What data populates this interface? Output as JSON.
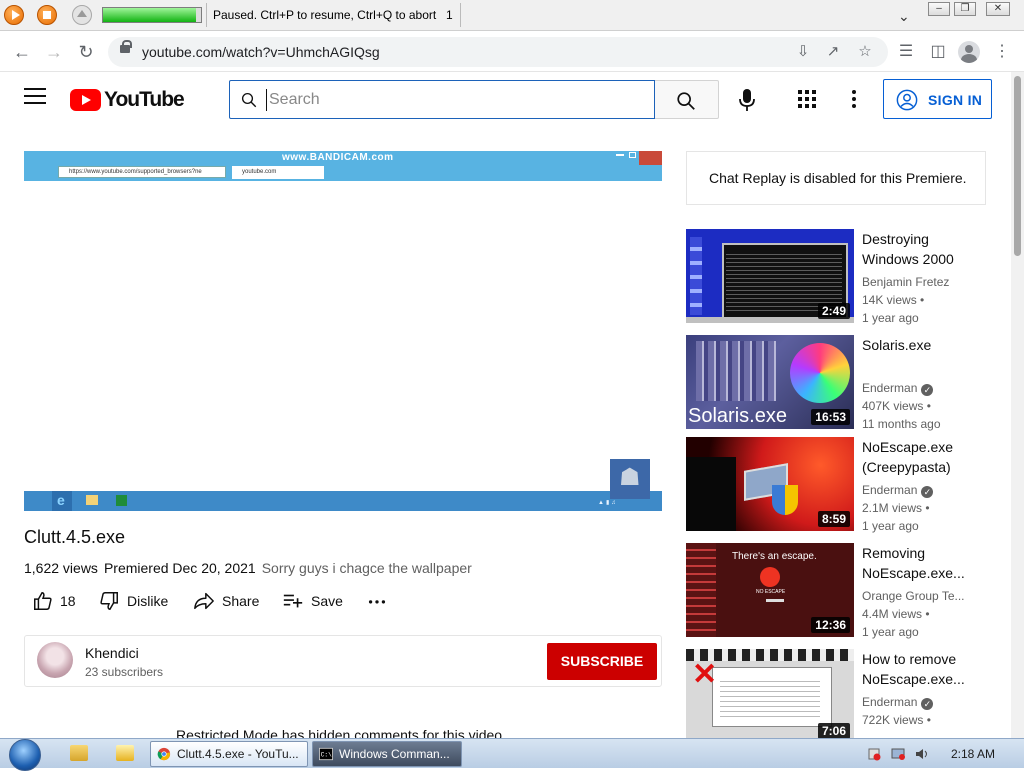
{
  "recorder": {
    "status": "Paused. Ctrl+P to resume, Ctrl+Q to abort",
    "count": "1",
    "progress": 0.95
  },
  "browser": {
    "url": "youtube.com/watch?v=UhmchAGIQsg"
  },
  "youtube": {
    "logo_text": "YouTube",
    "search_placeholder": "Search",
    "signin_label": "SIGN IN"
  },
  "player": {
    "watermark": "www.BANDICAM.com",
    "address": "https://www.youtube.com/supported_browsers?ne",
    "tab": "youtube.com"
  },
  "video": {
    "title": "Clutt.4.5.exe",
    "views": "1,622 views",
    "premiered": "Premiered Dec 20, 2021",
    "description": "Sorry guys i chagce the wallpaper",
    "actions": {
      "likes": "18",
      "dislike": "Dislike",
      "share": "Share",
      "save": "Save"
    }
  },
  "channel": {
    "name": "Khendici",
    "subscribers": "23 subscribers",
    "subscribe_label": "SUBSCRIBE"
  },
  "restricted_notice": "Restricted Mode has hidden comments for this video.",
  "chat_replay": "Chat Replay is disabled for this Premiere.",
  "recommendations": [
    {
      "title": "Destroying Windows 2000",
      "channel": "Benjamin Fretez",
      "views": "14K views •",
      "ago": "1 year ago",
      "duration": "2:49",
      "verified": false
    },
    {
      "title": "Solaris.exe",
      "channel": "Enderman",
      "views": "407K views •",
      "ago": "11 months ago",
      "duration": "16:53",
      "verified": true,
      "thumb_text": "Solaris.exe"
    },
    {
      "title": "NoEscape.exe (Creepypasta)",
      "channel": "Enderman",
      "views": "2.1M views •",
      "ago": "1 year ago",
      "duration": "8:59",
      "verified": true
    },
    {
      "title": "Removing NoEscape.exe...",
      "channel": "Orange Group Te...",
      "views": "4.4M views •",
      "ago": "1 year ago",
      "duration": "12:36",
      "verified": false,
      "thumb_text": "There's an escape.",
      "thumb_subtext": "NO ESCAPE"
    },
    {
      "title": "How to remove NoEscape.exe...",
      "channel": "Enderman",
      "views": "722K views •",
      "ago": "",
      "duration": "7:06",
      "verified": true
    }
  ],
  "taskbar": {
    "items": [
      {
        "label": "Clutt.4.5.exe - YouTu..."
      },
      {
        "label": "Windows Comman..."
      }
    ],
    "clock": "2:18 AM"
  },
  "colors": {
    "accent_blue": "#065fd4",
    "subscribe_red": "#cc0000",
    "youtube_red": "#ff0000"
  }
}
